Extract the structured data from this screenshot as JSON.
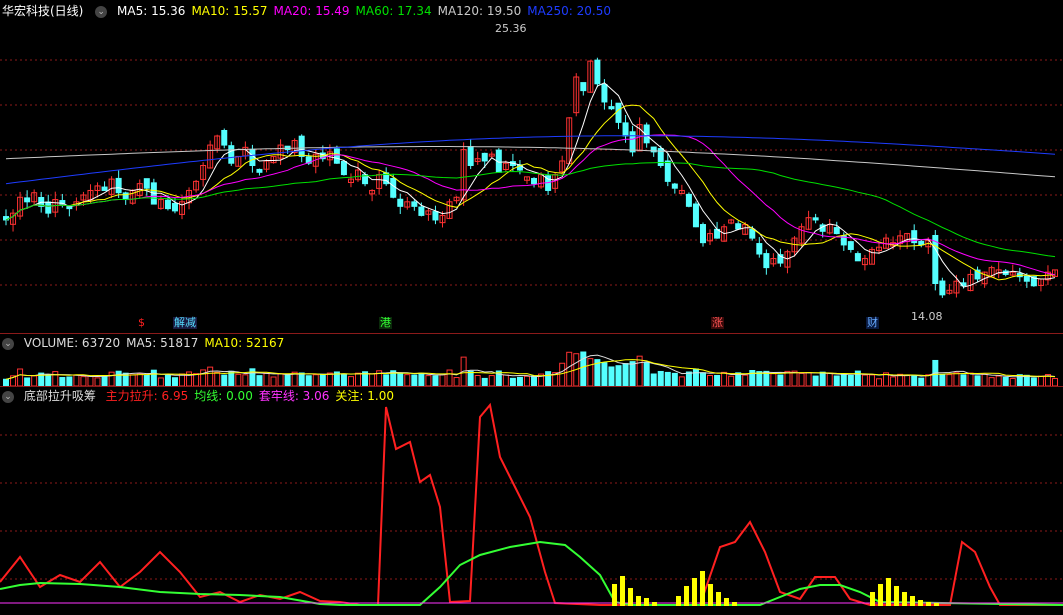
{
  "main": {
    "stock_title": "华宏科技(日线)",
    "ma": [
      {
        "label": "MA5: 15.36",
        "color": "#ffffff"
      },
      {
        "label": "MA10: 15.57",
        "color": "#ffff00"
      },
      {
        "label": "MA20: 15.49",
        "color": "#ff00ff"
      },
      {
        "label": "MA60: 17.34",
        "color": "#00e000"
      },
      {
        "label": "MA120: 19.50",
        "color": "#c8c8c8"
      },
      {
        "label": "MA250: 20.50",
        "color": "#1e3cff"
      }
    ],
    "high_tag": "25.36",
    "low_tag": "14.08",
    "events": [
      {
        "text": "$",
        "color": "#ff2020",
        "bg": "#000"
      },
      {
        "text": "解减",
        "color": "#55ddff",
        "bg": "#1a1a40"
      },
      {
        "text": "港",
        "color": "#33ff33",
        "bg": "#0a2a0a"
      },
      {
        "text": "涨",
        "color": "#ff5555",
        "bg": "#3a0a0a"
      },
      {
        "text": "财",
        "color": "#66aaff",
        "bg": "#0a1a40"
      }
    ]
  },
  "volume": {
    "items": [
      {
        "label": "VOLUME: 63720",
        "color": "#dddddd"
      },
      {
        "label": "MA5: 51817",
        "color": "#dddddd"
      },
      {
        "label": "MA10: 52167",
        "color": "#ffff00"
      }
    ]
  },
  "indicator": {
    "name": "底部拉升吸筹",
    "items": [
      {
        "label": "主力拉升: 6.95",
        "color": "#ff2020"
      },
      {
        "label": "均线: 0.00",
        "color": "#33ff33"
      },
      {
        "label": "套牢线: 3.06",
        "color": "#ff33ff"
      },
      {
        "label": "关注: 1.00",
        "color": "#ffff00"
      }
    ]
  },
  "colors": {
    "up": "#ff3232",
    "down": "#54ffff",
    "grid": "#8b1a1a"
  },
  "chart_data": [
    {
      "type": "candlestick",
      "title": "华宏科技(日线)",
      "ohlc_approx": {
        "note_free": true,
        "closes": [
          17.6,
          17.9,
          18.6,
          18.4,
          18.8,
          18.2,
          17.9,
          18.5,
          18.3,
          18.1,
          18.4,
          18.7,
          18.9,
          19.1,
          18.9,
          19.4,
          18.8,
          18.5,
          18.9,
          19.2,
          19.0,
          18.3,
          18.5,
          18.1,
          18.0,
          18.4,
          18.9,
          19.3,
          20.0,
          20.9,
          21.3,
          20.9,
          20.1,
          20.4,
          20.8,
          20.0,
          19.7,
          20.2,
          20.4,
          20.9,
          20.7,
          21.1,
          20.4,
          20.1,
          20.5,
          20.3,
          20.6,
          20.1,
          19.6,
          19.4,
          19.8,
          19.2,
          18.9,
          19.6,
          19.2,
          18.6,
          18.2,
          18.4,
          18.2,
          17.8,
          18.0,
          17.6,
          17.8,
          18.4,
          18.6,
          20.7,
          20.0,
          20.3,
          20.2,
          20.5,
          19.7,
          20.1,
          20.0,
          19.8,
          19.5,
          19.2,
          19.6,
          18.9,
          19.6,
          20.2,
          22.1,
          23.9,
          23.3,
          24.6,
          23.6,
          22.8,
          22.5,
          21.9,
          21.3,
          20.6,
          21.8,
          21.0,
          20.6,
          20.0,
          19.3,
          19.0,
          18.9,
          18.2,
          17.3,
          16.6,
          17.0,
          16.8,
          17.3,
          17.6,
          17.2,
          17.4,
          16.8,
          16.1,
          15.5,
          15.9,
          15.7,
          16.2,
          16.8,
          17.3,
          17.7,
          17.6,
          17.1,
          17.4,
          17.0,
          16.5,
          16.3,
          15.8,
          15.9,
          16.3,
          16.4,
          16.8,
          16.6,
          16.9,
          17.0,
          16.6,
          16.5,
          16.7,
          14.8,
          14.3,
          14.5,
          14.9,
          14.7,
          15.2,
          15.0,
          15.3,
          15.5,
          15.4,
          15.2,
          15.3,
          15.1,
          14.9,
          14.7,
          15.0,
          15.3,
          15.4
        ],
        "ylim": [
          13.5,
          26.5
        ]
      },
      "price_high": 25.36,
      "price_low": 14.08
    },
    {
      "type": "bar",
      "title": "VOLUME",
      "latest": 63720,
      "ma5": 51817,
      "ma10": 52167
    },
    {
      "type": "line",
      "title": "底部拉升吸筹",
      "series": [
        {
          "name": "主力拉升",
          "last": 6.95
        },
        {
          "name": "均线",
          "last": 0.0
        },
        {
          "name": "套牢线",
          "last": 3.06
        },
        {
          "name": "关注",
          "last": 1.0
        }
      ]
    }
  ]
}
